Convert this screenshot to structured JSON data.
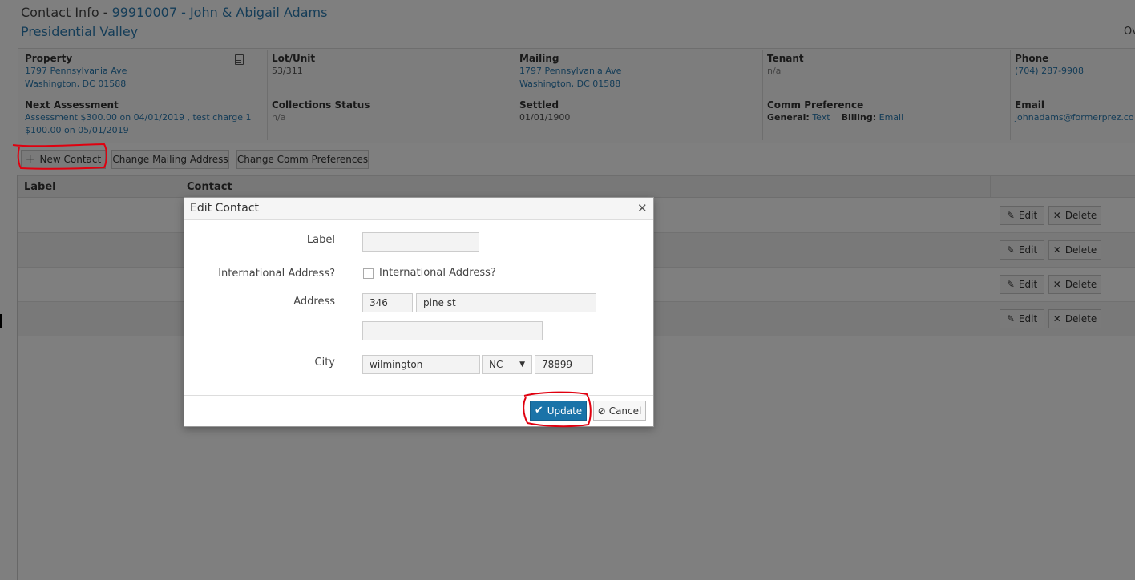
{
  "header": {
    "title_prefix": "Contact Info - ",
    "title_link": "99910007 - John & Abigail Adams",
    "subtitle": "Presidential Valley",
    "overflow_text": "Ov"
  },
  "info": {
    "property": {
      "label": "Property",
      "line1": "1797 Pennsylvania Ave",
      "line2": "Washington, DC 01588"
    },
    "lot_unit": {
      "label": "Lot/Unit",
      "value": "53/311"
    },
    "mailing": {
      "label": "Mailing",
      "line1": "1797 Pennsylvania Ave",
      "line2": "Washington, DC 01588"
    },
    "tenant": {
      "label": "Tenant",
      "value": "n/a"
    },
    "phone": {
      "label": "Phone",
      "value": "(704) 287-9908"
    },
    "next_assessment": {
      "label": "Next Assessment",
      "line1": "Assessment $300.00 on 04/01/2019 , test charge 1",
      "line2": "$100.00 on 05/01/2019"
    },
    "collections_status": {
      "label": "Collections Status",
      "value": "n/a"
    },
    "settled": {
      "label": "Settled",
      "value": "01/01/1900"
    },
    "comm_preference": {
      "label": "Comm Preference",
      "general_label": "General:",
      "general_value": "Text",
      "billing_label": "Billing:",
      "billing_value": "Email"
    },
    "email": {
      "label": "Email",
      "value": "johnadams@formerprez.co"
    }
  },
  "toolbar": {
    "new_contact": "New Contact",
    "change_mailing": "Change Mailing Address",
    "change_comm": "Change Comm Preferences"
  },
  "table": {
    "headers": {
      "label": "Label",
      "contact": "Contact"
    },
    "rows": [
      {
        "edit": "Edit",
        "delete": "Delete"
      },
      {
        "edit": "Edit",
        "delete": "Delete"
      },
      {
        "edit": "Edit",
        "delete": "Delete"
      },
      {
        "edit": "Edit",
        "delete": "Delete"
      }
    ]
  },
  "modal": {
    "title": "Edit Contact",
    "label_field": {
      "label": "Label",
      "value": ""
    },
    "international": {
      "label": "International Address?",
      "checkbox_label": "International Address?",
      "checked": false
    },
    "address": {
      "label": "Address",
      "number": "346",
      "street": "pine st",
      "line2": ""
    },
    "city": {
      "label": "City",
      "city": "wilmington",
      "state": "NC",
      "zip": "78899"
    },
    "update_label": "Update",
    "cancel_label": "Cancel"
  },
  "icons": {
    "plus": "plus-icon",
    "pencil": "pencil-icon",
    "x": "x-icon",
    "check": "check-icon",
    "ban": "ban-icon",
    "document": "document-icon",
    "caret": "caret-down-icon",
    "close": "close-icon"
  },
  "colors": {
    "link": "#2a7ab0",
    "primary_button": "#1a73a8",
    "annotation": "#e0000f"
  }
}
